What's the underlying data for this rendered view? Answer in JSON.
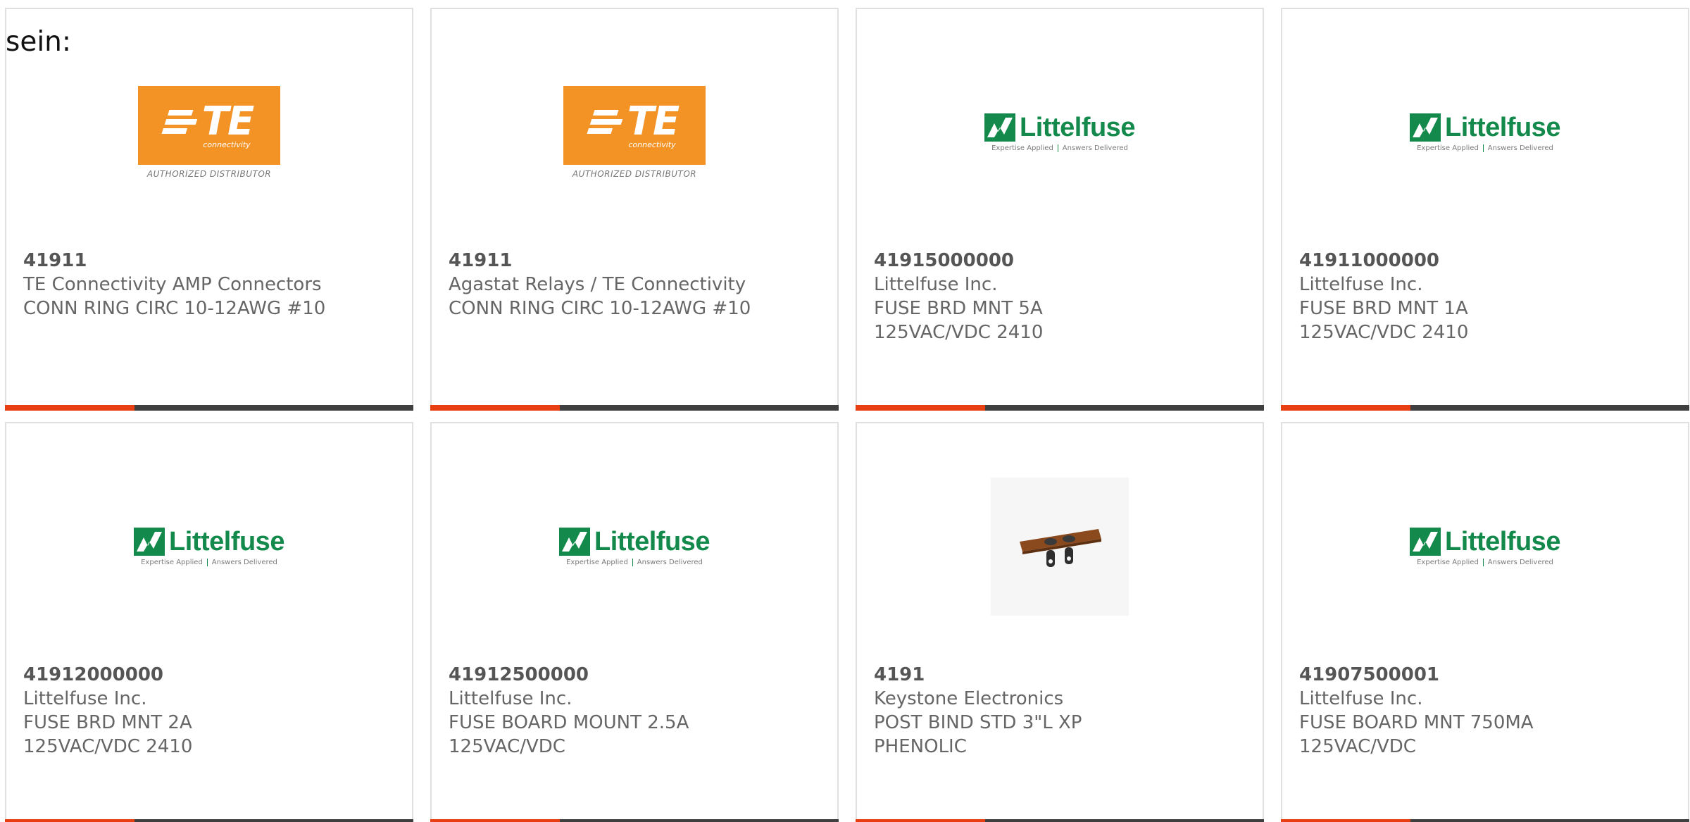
{
  "page_prefix": "sein:",
  "colors": {
    "accent": "#e83f12",
    "bar": "#3f3f3f",
    "te_orange": "#f39325",
    "littelfuse_green": "#138a4b"
  },
  "logos": {
    "te": {
      "letters": "TE",
      "sub": "connectivity",
      "distributor": "AUTHORIZED DISTRIBUTOR"
    },
    "littelfuse": {
      "word": "Littelfuse",
      "tagline_left": "Expertise Applied",
      "tagline_right": "Answers Delivered"
    }
  },
  "products": [
    {
      "part_number": "41911",
      "manufacturer": "TE Connectivity AMP Connectors",
      "description": "CONN RING CIRC 10-12AWG #10",
      "image": "te-logo"
    },
    {
      "part_number": "41911",
      "manufacturer": "Agastat Relays / TE Connectivity",
      "description": "CONN RING CIRC 10-12AWG #10",
      "image": "te-logo"
    },
    {
      "part_number": "41915000000",
      "manufacturer": "Littelfuse Inc.",
      "description": "FUSE BRD MNT 5A 125VAC/VDC 2410",
      "image": "littelfuse-logo"
    },
    {
      "part_number": "41911000000",
      "manufacturer": "Littelfuse Inc.",
      "description": "FUSE BRD MNT 1A 125VAC/VDC 2410",
      "image": "littelfuse-logo"
    },
    {
      "part_number": "41912000000",
      "manufacturer": "Littelfuse Inc.",
      "description": "FUSE BRD MNT 2A 125VAC/VDC 2410",
      "image": "littelfuse-logo"
    },
    {
      "part_number": "41912500000",
      "manufacturer": "Littelfuse Inc.",
      "description": "FUSE BOARD MOUNT 2.5A 125VAC/VDC",
      "image": "littelfuse-logo"
    },
    {
      "part_number": "4191",
      "manufacturer": "Keystone Electronics",
      "description": "POST BIND STD 3\"L XP PHENOLIC",
      "image": "product-photo"
    },
    {
      "part_number": "41907500001",
      "manufacturer": "Littelfuse Inc.",
      "description": "FUSE BOARD MNT 750MA 125VAC/VDC",
      "image": "littelfuse-logo"
    }
  ]
}
